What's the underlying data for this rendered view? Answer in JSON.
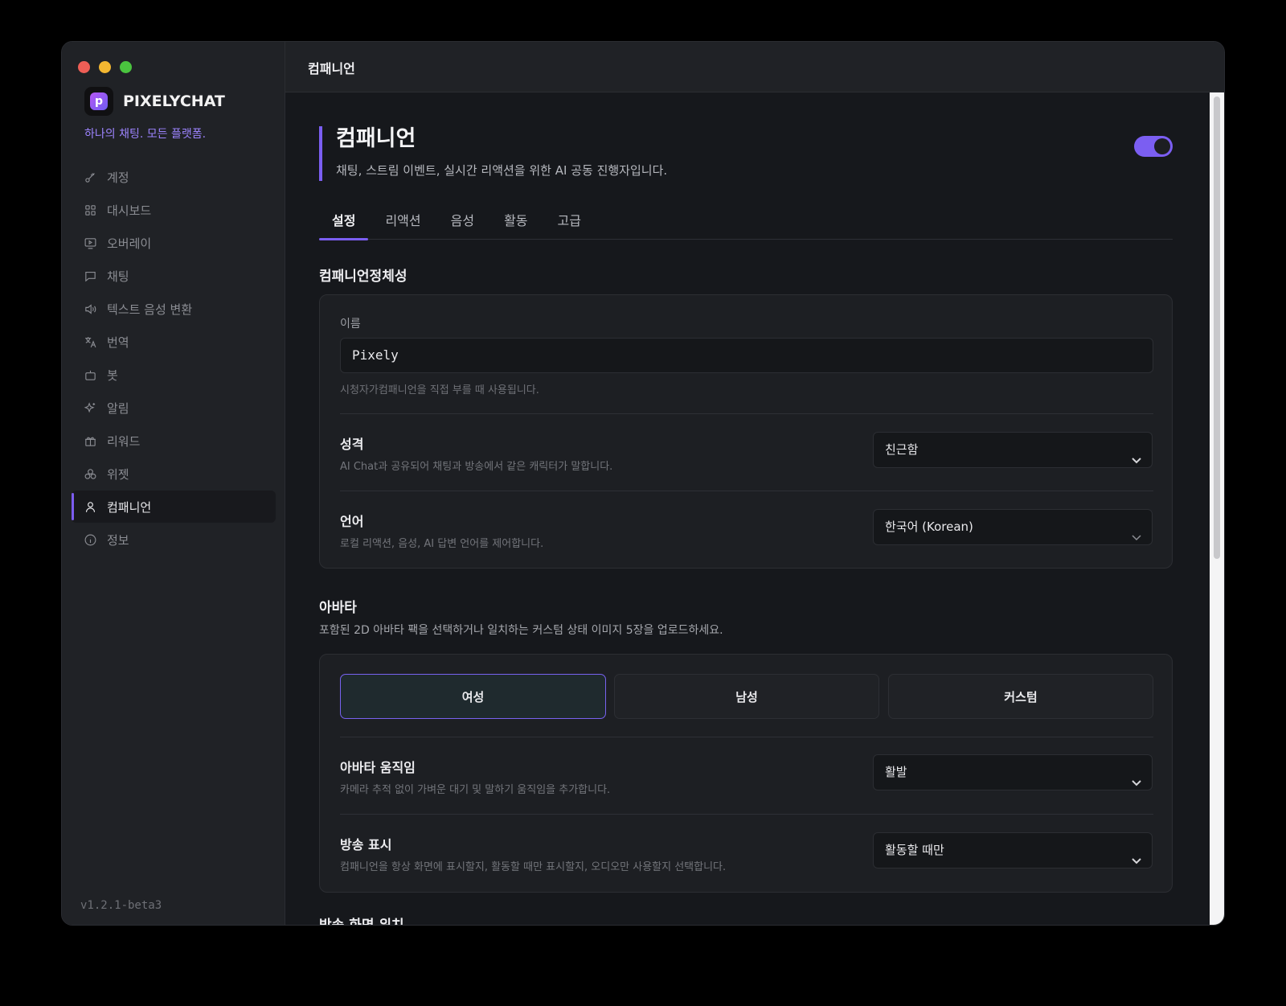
{
  "app": {
    "name": "PIXELYCHAT",
    "tagline": "하나의 채팅. 모든 플랫폼.",
    "version": "v1.2.1-beta3",
    "accent_color": "#7b5ef2"
  },
  "sidebar": {
    "items": [
      {
        "label": "계정",
        "icon": "key-icon"
      },
      {
        "label": "대시보드",
        "icon": "grid-icon"
      },
      {
        "label": "오버레이",
        "icon": "monitor-play-icon"
      },
      {
        "label": "채팅",
        "icon": "chat-icon"
      },
      {
        "label": "텍스트 음성 변환",
        "icon": "speaker-icon"
      },
      {
        "label": "번역",
        "icon": "translate-icon"
      },
      {
        "label": "봇",
        "icon": "bot-icon"
      },
      {
        "label": "알림",
        "icon": "sparkles-icon"
      },
      {
        "label": "리워드",
        "icon": "gift-icon"
      },
      {
        "label": "위젯",
        "icon": "widgets-icon"
      },
      {
        "label": "컴패니언",
        "icon": "user-icon",
        "active": true
      },
      {
        "label": "정보",
        "icon": "info-icon"
      }
    ]
  },
  "topbar": {
    "title": "컴패니언"
  },
  "page": {
    "title": "컴패니언",
    "subtitle": "채팅, 스트림 이벤트, 실시간 리액션을 위한 AI 공동 진행자입니다.",
    "enabled": true
  },
  "tabs": [
    {
      "label": "설정",
      "active": true
    },
    {
      "label": "리액션"
    },
    {
      "label": "음성"
    },
    {
      "label": "활동"
    },
    {
      "label": "고급"
    }
  ],
  "identity": {
    "section_title": "컴패니언정체성",
    "name_label": "이름",
    "name_value": "Pixely",
    "name_hint": "시청자가컴패니언을 직접 부를 때 사용됩니다.",
    "personality_title": "성격",
    "personality_desc": "AI Chat과 공유되어 채팅과 방송에서 같은 캐릭터가 말합니다.",
    "personality_value": "친근함",
    "language_title": "언어",
    "language_desc": "로컬 리액션, 음성, AI 답변 언어를 제어합니다.",
    "language_value": "한국어 (Korean)"
  },
  "avatar": {
    "section_title": "아바타",
    "section_desc": "포함된 2D 아바타 팩을 선택하거나 일치하는 커스텀 상태 이미지 5장을 업로드하세요.",
    "options": [
      {
        "label": "여성",
        "active": true
      },
      {
        "label": "남성"
      },
      {
        "label": "커스텀"
      }
    ],
    "motion_title": "아바타 움직임",
    "motion_desc": "카메라 추적 없이 가벼운 대기 및 말하기 움직임을 추가합니다.",
    "motion_value": "활발",
    "display_title": "방송 표시",
    "display_desc": "컴패니언을 항상 화면에 표시할지, 활동할 때만 표시할지, 오디오만 사용할지 선택합니다.",
    "display_value": "활동할 때만"
  },
  "next_section": {
    "title": "방송 화면 위치"
  }
}
